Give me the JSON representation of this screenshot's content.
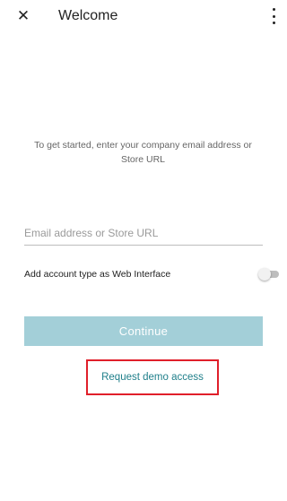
{
  "app_bar": {
    "close_icon_glyph": "✕",
    "title": "Welcome",
    "overflow_icon": "more-vert-icon"
  },
  "intro": {
    "text": "To get started, enter your company email address or Store URL"
  },
  "email": {
    "placeholder": "Email address or Store URL",
    "value": ""
  },
  "account_type": {
    "label": "Add account type as Web Interface",
    "toggle_on": false
  },
  "continue": {
    "label": "Continue",
    "enabled": false
  },
  "demo": {
    "label": "Request demo access"
  },
  "colors": {
    "accent": "#1f7f8a",
    "continue_disabled_bg": "#a3cfd8",
    "highlight_border": "#e01f2a"
  }
}
